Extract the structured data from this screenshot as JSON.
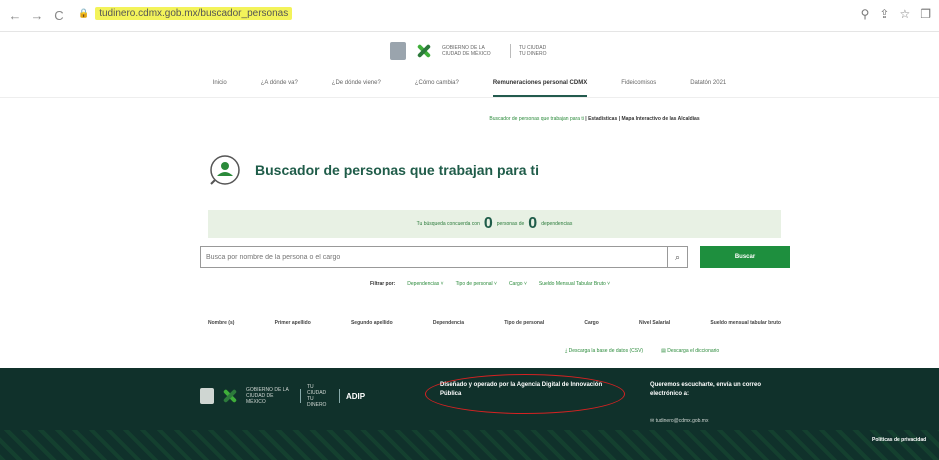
{
  "browser": {
    "url": "tudinero.cdmx.gob.mx/buscador_personas"
  },
  "header": {
    "gov_text": "GOBIERNO DE LA CIUDAD DE MÉXICO",
    "slogan": "TU CIUDAD TU DINERO"
  },
  "nav": {
    "items": [
      {
        "label": "Inicio"
      },
      {
        "label": "¿A dónde va?"
      },
      {
        "label": "¿De dónde viene?"
      },
      {
        "label": "¿Cómo cambia?"
      },
      {
        "label": "Remuneraciones personal CDMX"
      },
      {
        "label": "Fideicomisos"
      },
      {
        "label": "Datatón 2021"
      }
    ]
  },
  "sub_links": {
    "first": "Buscador de personas que trabajan para ti",
    "sep1": "|",
    "second": "Estadísticas",
    "sep2": "|",
    "third": "Mapa Interactivo de las Alcaldías"
  },
  "main": {
    "title": "Buscador de personas que trabajan para ti",
    "result_prefix": "Tu búsqueda concuerda con",
    "persons_count": "0",
    "persons_label": "personas de",
    "deps_count": "0",
    "deps_label": "dependencias",
    "search_placeholder": "Busca por nombre de la persona o el cargo",
    "search_button": "Buscar",
    "filter_label": "Filtrar por:",
    "filters": [
      "Dependencias ˅",
      "Tipo de personal ˅",
      "Cargo ˅",
      "Sueldo Mensual Tabular Bruto ˅"
    ]
  },
  "table": {
    "headers": [
      "Nombre (s)",
      "Primer apellido",
      "Segundo apellido",
      "Dependencia",
      "Tipo de personal",
      "Cargo",
      "Nivel Salarial",
      "Sueldo mensual tabular bruto"
    ]
  },
  "downloads": {
    "db": "Descarga la base de datos (CSV)",
    "dict": "Descarga el diccionario"
  },
  "footer": {
    "gov_text": "GOBIERNO DE LA CIUDAD DE MÉXICO",
    "slogan": "TU CIUDAD TU DINERO",
    "adip": "ADIP",
    "designed_by": "Diseñado y operado por la Agencia Digital de Innovación Pública",
    "feedback": "Queremos escucharte, envía un correo electrónico a:",
    "email": "tudinero@cdmx.gob.mx",
    "privacy": "Políticas de privacidad"
  }
}
